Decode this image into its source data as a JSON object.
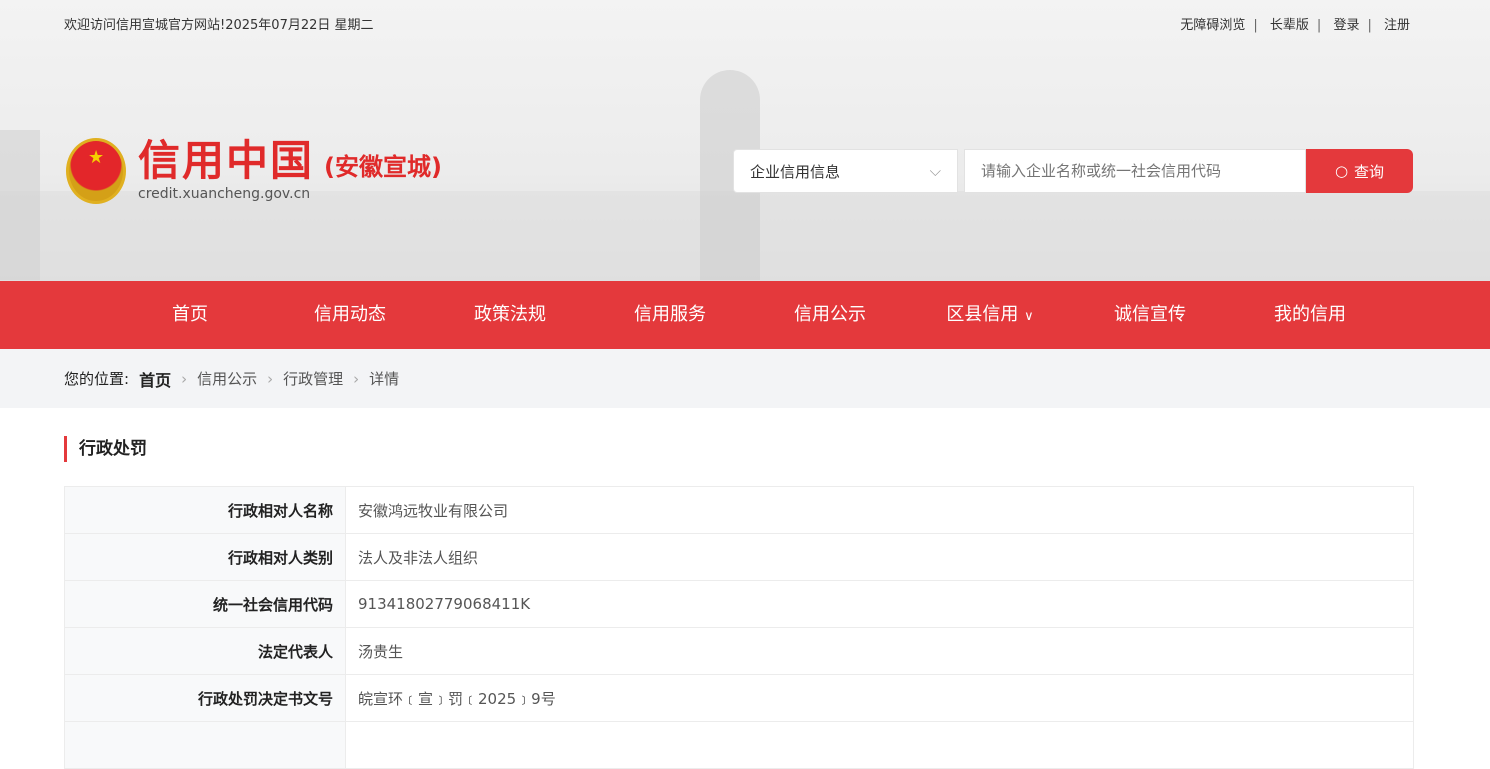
{
  "topbar": {
    "welcome": "欢迎访问信用宣城官方网站!",
    "date": "2025年07月22日 星期二",
    "links": [
      "无障碍浏览",
      "长辈版",
      "登录",
      "注册"
    ]
  },
  "logo": {
    "main": "信用中国",
    "sub": "(安徽宣城)",
    "url": "credit.xuancheng.gov.cn"
  },
  "search": {
    "select_value": "企业信用信息",
    "placeholder": "请输入企业名称或统一社会信用代码",
    "button": "查询"
  },
  "nav": [
    "首页",
    "信用动态",
    "政策法规",
    "信用服务",
    "信用公示",
    "区县信用",
    "诚信宣传",
    "我的信用"
  ],
  "breadcrumb": {
    "label": "您的位置:",
    "items": [
      "首页",
      "信用公示",
      "行政管理",
      "详情"
    ]
  },
  "section_title": "行政处罚",
  "rows": [
    {
      "k": "行政相对人名称",
      "v": "安徽鸿远牧业有限公司"
    },
    {
      "k": "行政相对人类别",
      "v": "法人及非法人组织"
    },
    {
      "k": "统一社会信用代码",
      "v": "91341802779068411K"
    },
    {
      "k": "法定代表人",
      "v": "汤贵生"
    },
    {
      "k": "行政处罚决定书文号",
      "v": "皖宣环﹝宣﹞罚﹝2025﹞9号"
    }
  ],
  "colors": {
    "accent": "#e4393c"
  }
}
